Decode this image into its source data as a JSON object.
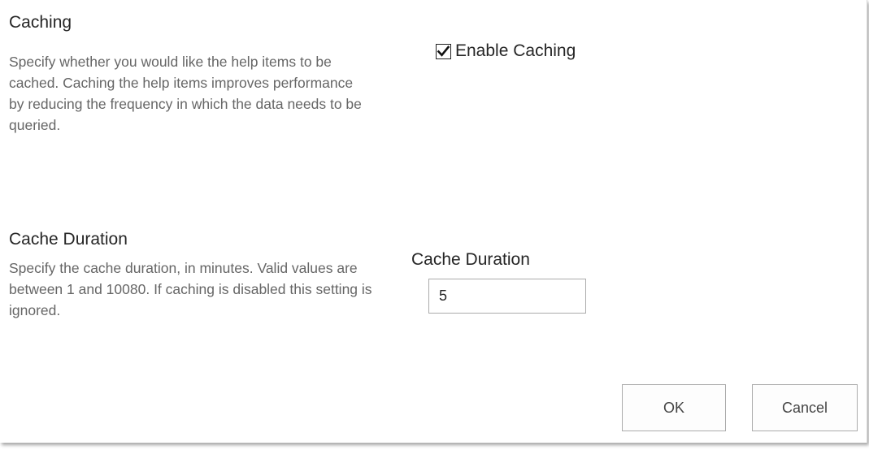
{
  "caching": {
    "title": "Caching",
    "description": "Specify whether you would like the help items to be cached. Caching the help items improves performance by reducing the frequency in which the data needs to be queried.",
    "enable_label": "Enable Caching",
    "enabled": true
  },
  "cache_duration": {
    "title": "Cache Duration",
    "description": "Specify the cache duration, in minutes. Valid values are between 1 and 10080. If caching is disabled this setting is ignored.",
    "field_label": "Cache Duration",
    "value": "5"
  },
  "buttons": {
    "ok_label": "OK",
    "cancel_label": "Cancel"
  },
  "icons": {
    "checkbox": "checkmark-icon"
  }
}
